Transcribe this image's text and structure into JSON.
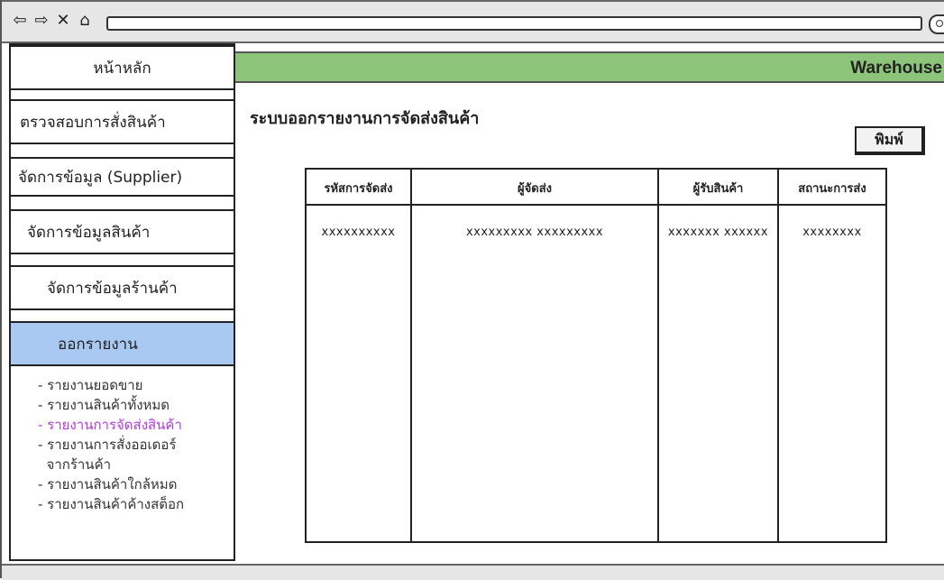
{
  "browser": {
    "nav_icons": [
      "back-arrow-icon",
      "forward-arrow-icon",
      "close-icon",
      "home-icon"
    ]
  },
  "header": {
    "brand": "Warehouse"
  },
  "sidebar": {
    "items": [
      {
        "label": "หน้าหลัก",
        "active": false
      },
      {
        "label": "ตรวจสอบการสั่งสินค้า",
        "active": false
      },
      {
        "label": "จัดการข้อมูล (Supplier)",
        "active": false
      },
      {
        "label": "จัดการข้อมูลสินค้า",
        "active": false
      },
      {
        "label": "จัดการข้อมูลร้านค้า",
        "active": false
      },
      {
        "label": "ออกรายงาน",
        "active": true
      }
    ],
    "sub_items": [
      "- รายงานยอดขาย",
      "- รายงานสินค้าทั้งหมด",
      "- รายงานการจัดส่งสินค้า",
      "- รายงานการสั่งออเดอร์",
      "  จากร้านค้า",
      "- รายงานสินค้าใกล้หมด",
      "- รายงานสินค้าค้างสต็อก"
    ],
    "current_sub_index": 2
  },
  "main": {
    "title": "ระบบออกรายงานการจัดส่งสินค้า",
    "print_label": "พิมพ์",
    "table": {
      "headers": [
        "รหัสการจัดส่ง",
        "ผู้จัดส่ง",
        "ผู้รับสินค้า",
        "สถานะการส่ง"
      ],
      "rows": [
        [
          "xxxxxxxxxx",
          "xxxxxxxxx xxxxxxxxx",
          "xxxxxxx xxxxxx",
          "xxxxxxxx"
        ]
      ]
    }
  },
  "colors": {
    "header_green": "#8cc47a",
    "active_menu_blue": "#a9c9f2",
    "current_link_purple": "#b23bd9"
  }
}
